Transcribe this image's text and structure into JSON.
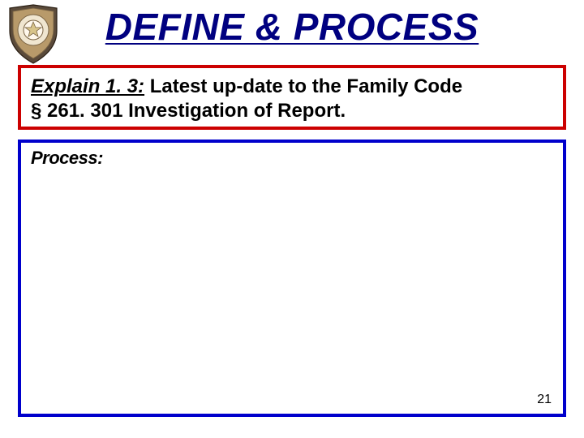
{
  "title": "DEFINE & PROCESS",
  "explain": {
    "label": "Explain 1. 3:",
    "text_part1": " Latest up-date to the Family Code",
    "text_part2": "§ 261. 301 Investigation of Report."
  },
  "process": {
    "label": "Process:"
  },
  "page_number": "21",
  "icon": {
    "name": "constable-badge"
  }
}
